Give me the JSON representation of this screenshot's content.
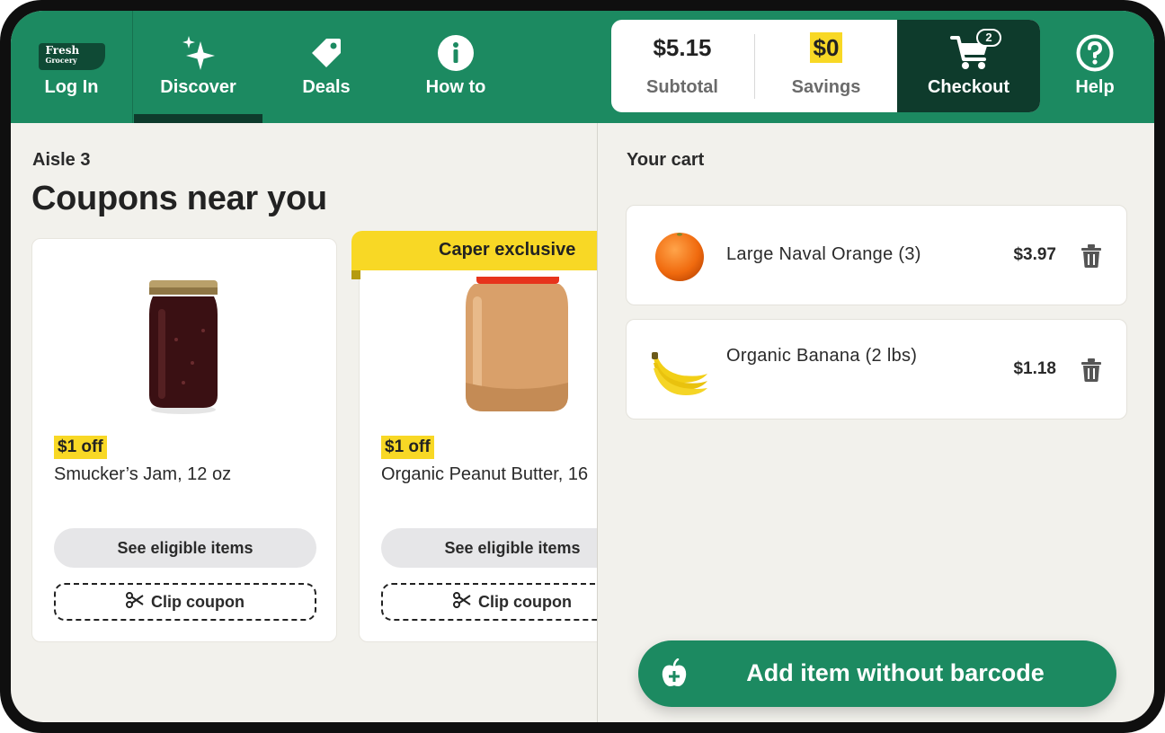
{
  "header": {
    "logo": {
      "line1": "Fresh",
      "line2": "Grocery"
    },
    "nav": {
      "login": {
        "label": "Log In"
      },
      "discover": {
        "label": "Discover",
        "icon": "sparkle-icon",
        "active": true
      },
      "deals": {
        "label": "Deals",
        "icon": "tag-icon"
      },
      "howto": {
        "label": "How to",
        "icon": "info-icon"
      },
      "help": {
        "label": "Help",
        "icon": "question-icon"
      }
    },
    "summary": {
      "subtotal_value": "$5.15",
      "subtotal_label": "Subtotal",
      "savings_value": "$0",
      "savings_label": "Savings",
      "checkout_label": "Checkout",
      "cart_count": "2"
    }
  },
  "coupons": {
    "aisle": "Aisle 3",
    "title": "Coupons near you",
    "exclusive_label": "Caper exclusive",
    "cards": [
      {
        "discount": "$1 off",
        "name": "Smucker’s Jam, 12 oz",
        "eligible_label": "See eligible items",
        "clip_label": "Clip coupon",
        "image": "jam-jar"
      },
      {
        "discount": "$1 off",
        "name": "Organic Peanut Butter, 16",
        "eligible_label": "See eligible items",
        "clip_label": "Clip coupon",
        "image": "peanut-butter-jar"
      }
    ]
  },
  "cart": {
    "title": "Your cart",
    "items": [
      {
        "name": "Large Naval Orange (3)",
        "price": "$3.97",
        "image": "orange"
      },
      {
        "name": "Organic Banana (2 lbs)",
        "price": "$1.18",
        "image": "bananas"
      }
    ],
    "add_button_label": "Add item without barcode"
  },
  "colors": {
    "brand_green": "#1c8a61",
    "dark_green": "#0e3b2c",
    "highlight_yellow": "#f8d825",
    "background": "#f2f1ec"
  }
}
